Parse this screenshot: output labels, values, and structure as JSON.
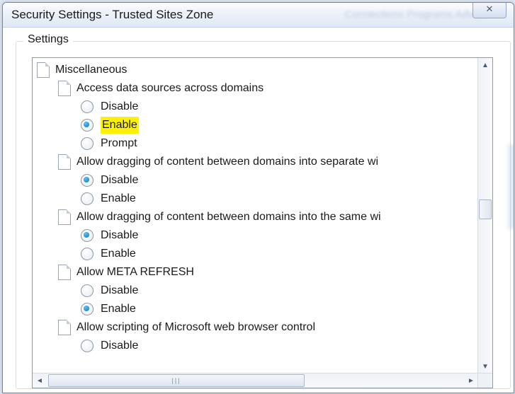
{
  "window": {
    "title": "Security Settings - Trusted Sites Zone",
    "close_glyph": "✕"
  },
  "bg_tabs_blur": "Connections    Programs    Advan",
  "group": {
    "label": "Settings"
  },
  "tree": {
    "root": {
      "label": "Miscellaneous"
    },
    "items": [
      {
        "label": "Access data sources across domains",
        "options": [
          {
            "label": "Disable",
            "selected": false,
            "highlight": false
          },
          {
            "label": "Enable",
            "selected": true,
            "highlight": true
          },
          {
            "label": "Prompt",
            "selected": false,
            "highlight": false
          }
        ]
      },
      {
        "label": "Allow dragging of content between domains into separate wi",
        "options": [
          {
            "label": "Disable",
            "selected": true,
            "highlight": false
          },
          {
            "label": "Enable",
            "selected": false,
            "highlight": false
          }
        ]
      },
      {
        "label": "Allow dragging of content between domains into the same wi",
        "options": [
          {
            "label": "Disable",
            "selected": true,
            "highlight": false
          },
          {
            "label": "Enable",
            "selected": false,
            "highlight": false
          }
        ]
      },
      {
        "label": "Allow META REFRESH",
        "options": [
          {
            "label": "Disable",
            "selected": false,
            "highlight": false
          },
          {
            "label": "Enable",
            "selected": true,
            "highlight": false
          }
        ]
      },
      {
        "label": "Allow scripting of Microsoft web browser control",
        "options": [
          {
            "label": "Disable",
            "selected": false,
            "highlight": false
          }
        ]
      }
    ]
  }
}
